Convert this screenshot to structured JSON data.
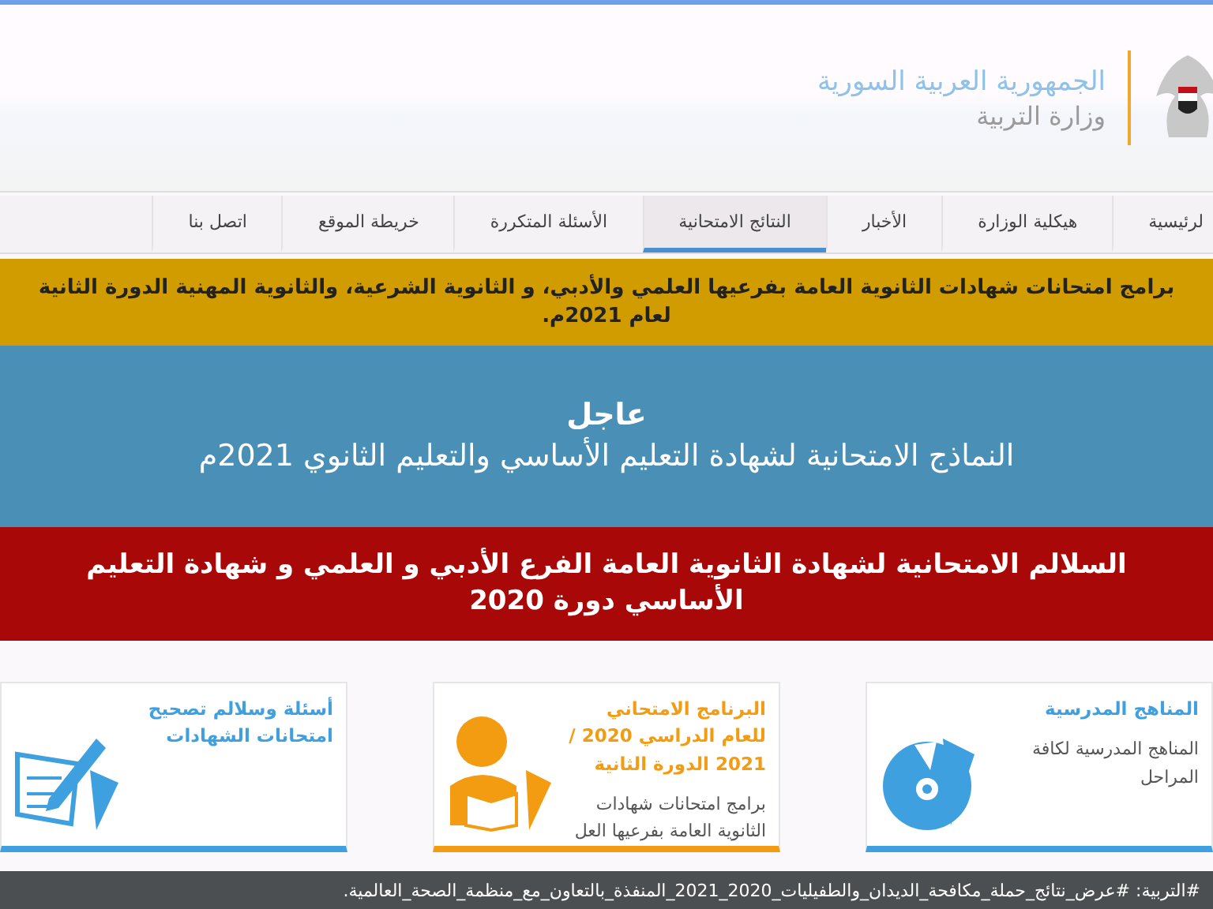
{
  "header": {
    "title": "الجمهورية العربية السورية",
    "subtitle": "وزارة التربية"
  },
  "nav": [
    {
      "label": "لرئيسية",
      "selected": false
    },
    {
      "label": "هيكلية الوزارة",
      "selected": false
    },
    {
      "label": "الأخبار",
      "selected": false
    },
    {
      "label": "النتائج الامتحانية",
      "selected": true
    },
    {
      "label": "الأسئلة المتكررة",
      "selected": false
    },
    {
      "label": "خريطة الموقع",
      "selected": false
    },
    {
      "label": "اتصل بنا",
      "selected": false
    }
  ],
  "banners": [
    {
      "kind": "notice",
      "lines": [
        "برامج امتحانات شهادات الثانوية العامة بفرعيها العلمي والأدبي، و الثانوية الشرعية، والثانوية المهنية الدورة الثانية لعام 2021م."
      ]
    },
    {
      "kind": "urgent",
      "lines": [
        "عاجل",
        "النماذج الامتحانية لشهادة التعليم الأساسي والتعليم الثانوي 2021م"
      ]
    },
    {
      "kind": "alert",
      "lines": [
        "السلالم الامتحانية لشهادة الثانوية العامة الفرع الأدبي و العلمي و شهادة التعليم الأساسي دورة 2020"
      ]
    }
  ],
  "cards": [
    {
      "kind": "disc",
      "color": "#3fa0e0",
      "title": "المناهج المدرسية",
      "text": "المناهج المدرسية لكافة المراحل"
    },
    {
      "kind": "reader",
      "color": "#f39c12",
      "title": "البرنامج الامتحاني للعام الدراسي 2020 / 2021 الدورة الثانية",
      "text": "برامج امتحانات شهادات الثانوية العامة بفرعيها العل"
    },
    {
      "kind": "pencil",
      "color": "#3fa0e0",
      "title": "أسئلة وسلالم تصحيح امتحانات الشهادات"
    }
  ],
  "ticker": "#التربية: #عرض_نتائج_حملة_مكافحة_الديدان_والطفيليات_2020_2021_المنفذة_بالتعاون_مع_منظمة_الصحة_العالمية."
}
